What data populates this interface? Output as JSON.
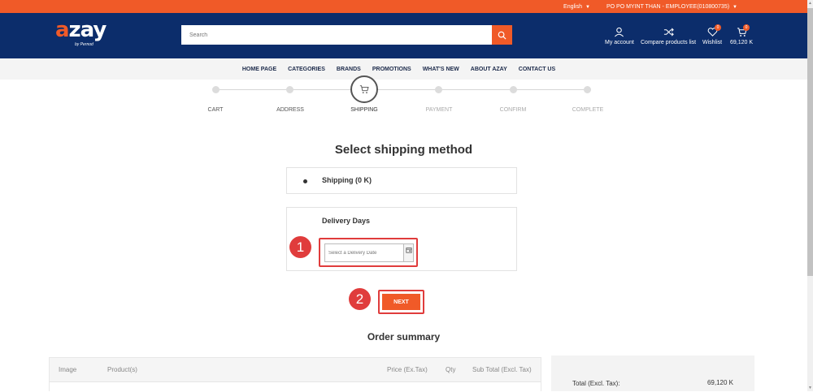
{
  "topbar": {
    "language": "English",
    "user": "PO PO MYINT THAN - EMPLOYEE(010800735)"
  },
  "header": {
    "logo_text": "azay",
    "logo_sub": "by Pernod",
    "search_placeholder": "Search",
    "my_account": "My account",
    "compare": "Compare products list",
    "wishlist": "Wishlist",
    "wishlist_count": "0",
    "cart_count": "0",
    "cart_total": "69,120 K"
  },
  "nav": [
    "HOME PAGE",
    "CATEGORIES",
    "BRANDS",
    "PROMOTIONS",
    "WHAT'S NEW",
    "ABOUT AZAY",
    "CONTACT US"
  ],
  "steps": [
    "CART",
    "ADDRESS",
    "SHIPPING",
    "PAYMENT",
    "CONFIRM",
    "COMPLETE"
  ],
  "main": {
    "title": "Select shipping method",
    "shipping_option": "Shipping (0 K)",
    "delivery_days_label": "Delivery Days",
    "date_placeholder": "Select a Delivery Date",
    "next_label": "NEXT"
  },
  "callouts": [
    "1",
    "2"
  ],
  "summary": {
    "title": "Order summary",
    "columns": [
      "Image",
      "Product(s)",
      "Price (Ex.Tax)",
      "Qty",
      "Sub Total (Excl. Tax)"
    ],
    "total_label": "Total (Excl. Tax):",
    "total_value": "69,120 K"
  },
  "colors": {
    "brand_orange": "#f05a28",
    "header_navy": "#0c2d6b",
    "callout_red": "#e03c3c"
  }
}
